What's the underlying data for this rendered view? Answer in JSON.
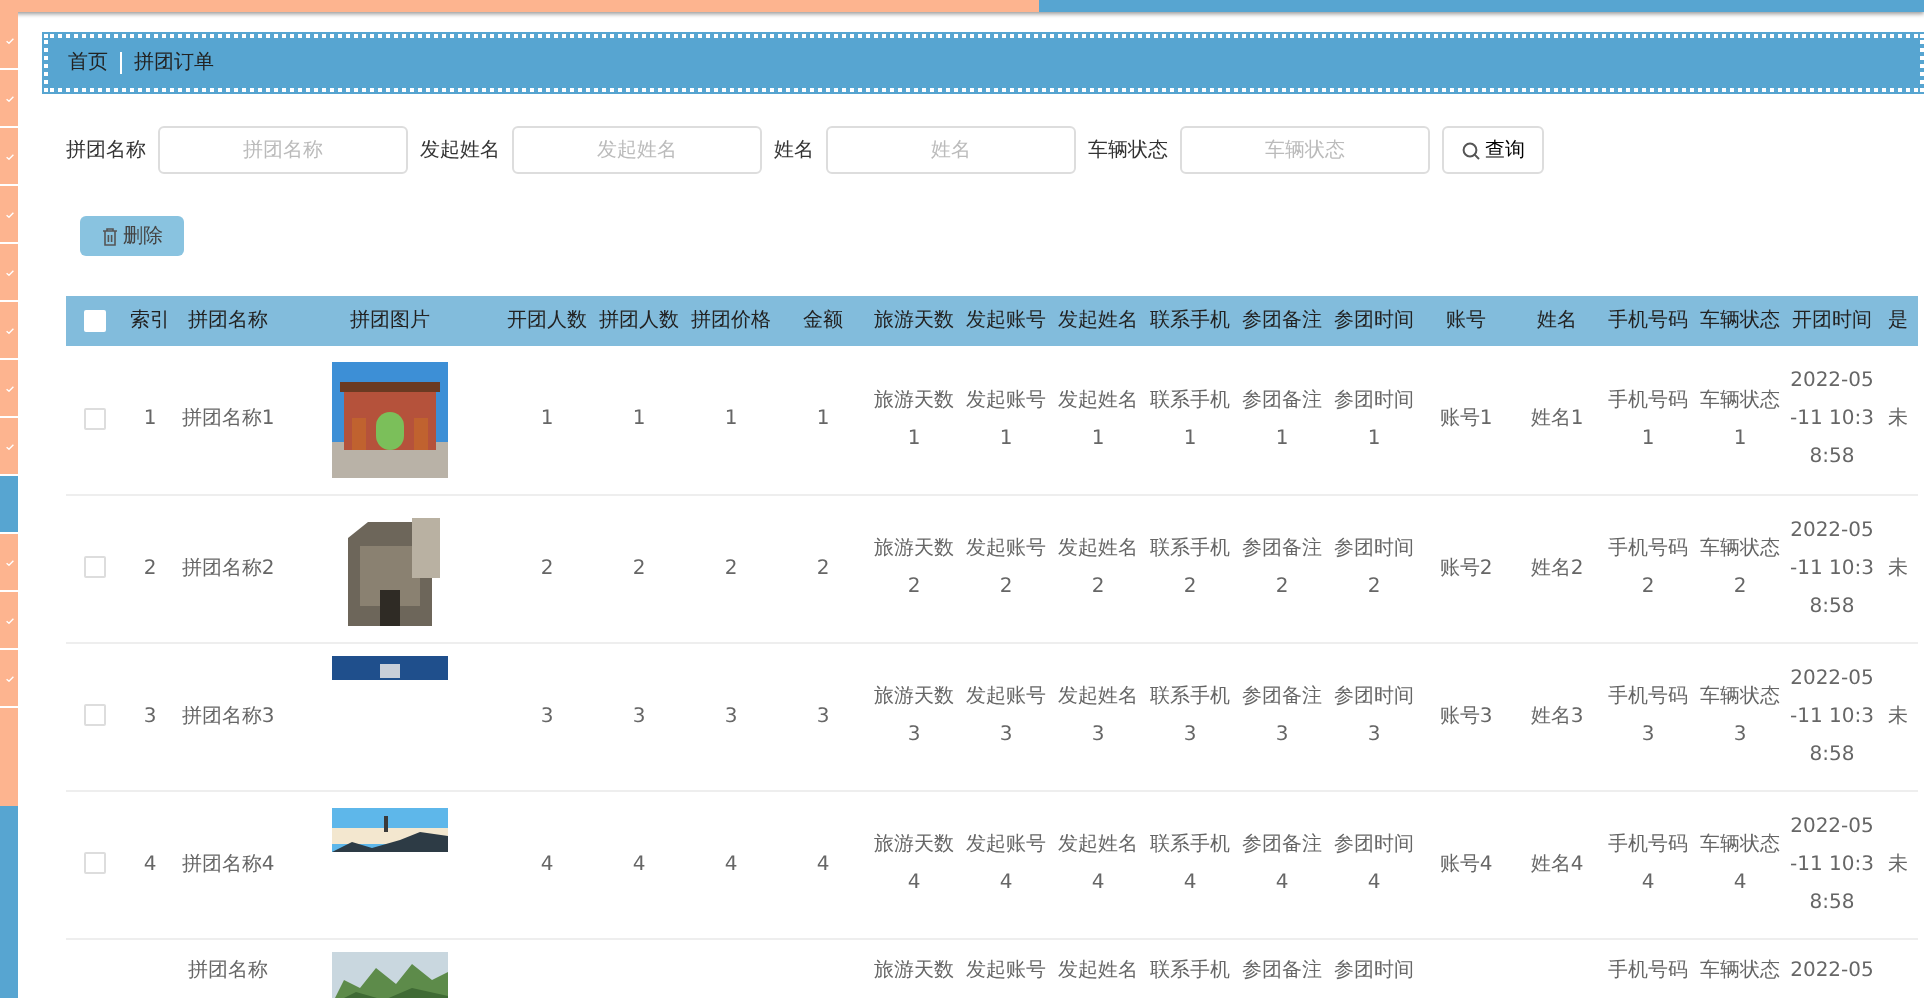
{
  "sidebar": {
    "items": [
      {
        "selected": false
      },
      {
        "selected": false
      },
      {
        "selected": false
      },
      {
        "selected": false
      },
      {
        "selected": false
      },
      {
        "selected": false
      },
      {
        "selected": false
      },
      {
        "selected": false
      },
      {
        "selected": true
      },
      {
        "selected": false
      },
      {
        "selected": false
      },
      {
        "selected": false
      }
    ]
  },
  "breadcrumb": [
    "首页",
    "拼团订单"
  ],
  "search": {
    "fields": [
      {
        "label": "拼团名称",
        "placeholder": "拼团名称"
      },
      {
        "label": "发起姓名",
        "placeholder": "发起姓名"
      },
      {
        "label": "姓名",
        "placeholder": "姓名"
      },
      {
        "label": "车辆状态",
        "placeholder": "车辆状态"
      }
    ],
    "button": "查询"
  },
  "delete_button": "删除",
  "table": {
    "header_checked": false,
    "columns": [
      "索引",
      "拼团名称",
      "拼团图片",
      "开团人数",
      "拼团人数",
      "拼团价格",
      "金额",
      "旅游天数",
      "发起账号",
      "发起姓名",
      "联系手机",
      "参团备注",
      "参团时间",
      "账号",
      "姓名",
      "手机号码",
      "车辆状态",
      "开团时间",
      "是"
    ],
    "rows": [
      {
        "checked": false,
        "cells": [
          "1",
          "拼团名称1",
          {
            "kind": "picture"
          },
          "1",
          "1",
          "1",
          "1",
          "旅游天数1",
          "发起账号1",
          "发起姓名1",
          "联系手机1",
          "参团备注1",
          "参团时间1",
          "账号1",
          "姓名1",
          "手机号码1",
          "车辆状态1",
          "2022-05-11 10:38:58",
          "未"
        ]
      },
      {
        "checked": false,
        "cells": [
          "2",
          "拼团名称2",
          {
            "kind": "picture"
          },
          "2",
          "2",
          "2",
          "2",
          "旅游天数2",
          "发起账号2",
          "发起姓名2",
          "联系手机2",
          "参团备注2",
          "参团时间2",
          "账号2",
          "姓名2",
          "手机号码2",
          "车辆状态2",
          "2022-05-11 10:38:58",
          "未"
        ]
      },
      {
        "checked": false,
        "cells": [
          "3",
          "拼团名称3",
          {
            "kind": "picture"
          },
          "3",
          "3",
          "3",
          "3",
          "旅游天数3",
          "发起账号3",
          "发起姓名3",
          "联系手机3",
          "参团备注3",
          "参团时间3",
          "账号3",
          "姓名3",
          "手机号码3",
          "车辆状态3",
          "2022-05-11 10:38:58",
          "未"
        ]
      },
      {
        "checked": false,
        "cells": [
          "4",
          "拼团名称4",
          {
            "kind": "picture"
          },
          "4",
          "4",
          "4",
          "4",
          "旅游天数4",
          "发起账号4",
          "发起姓名4",
          "联系手机4",
          "参团备注4",
          "参团时间4",
          "账号4",
          "姓名4",
          "手机号码4",
          "车辆状态4",
          "2022-05-11 10:38:58",
          "未"
        ]
      },
      {
        "cells": [
          null,
          "拼团名称",
          {
            "kind": "picture"
          },
          null,
          null,
          null,
          null,
          "旅游天数",
          "发起账号",
          "发起姓名",
          "联系手机",
          "参团备注",
          "参团时间",
          null,
          null,
          "手机号码",
          "车辆状态",
          "2022-05",
          null
        ]
      }
    ]
  }
}
